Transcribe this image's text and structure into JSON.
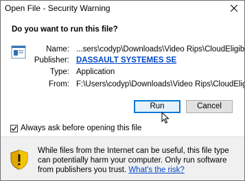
{
  "window": {
    "title": "Open File - Security Warning"
  },
  "heading": "Do you want to run this file?",
  "details": {
    "name_label": "Name:",
    "name_value": "...sers\\codyp\\Downloads\\Video Rips\\CloudEligibility.exe",
    "publisher_label": "Publisher:",
    "publisher_value": "DASSAULT SYSTEMES SE",
    "type_label": "Type:",
    "type_value": "Application",
    "from_label": "From:",
    "from_value": "F:\\Users\\codyp\\Downloads\\Video Rips\\CloudEligibility...."
  },
  "buttons": {
    "run": "Run",
    "cancel": "Cancel"
  },
  "checkbox": {
    "label": "Always ask before opening this file",
    "checked": true
  },
  "warning": {
    "text": "While files from the Internet can be useful, this file type can potentially harm your computer. Only run software from publishers you trust.",
    "link": "What's the risk?"
  },
  "colors": {
    "link": "#0046c8",
    "accent": "#0078d7",
    "shield_yellow": "#f5c400"
  }
}
